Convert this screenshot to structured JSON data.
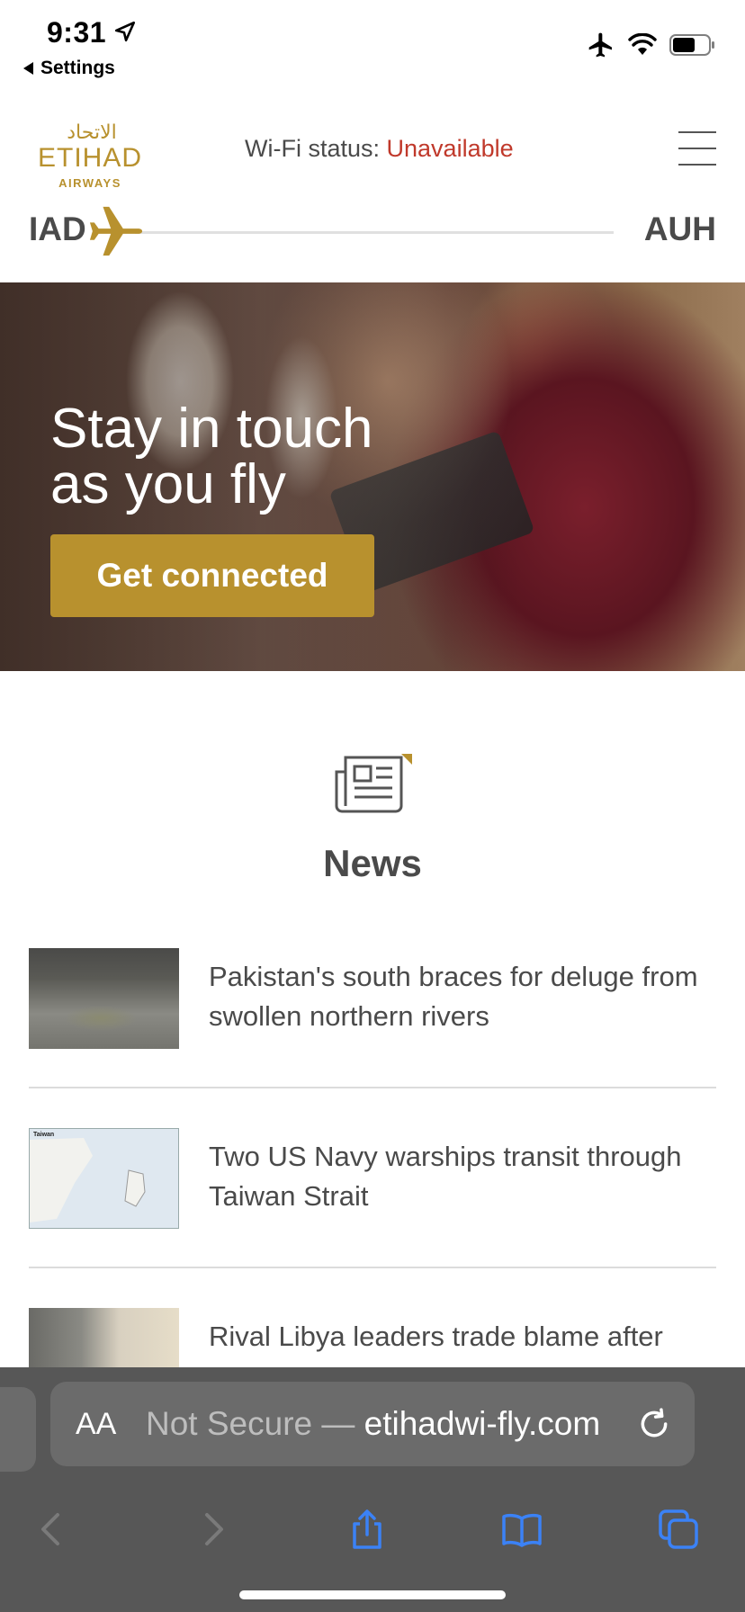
{
  "status_bar": {
    "time": "9:31",
    "back_label": "Settings"
  },
  "header": {
    "logo_arabic": "الاتحاد",
    "logo_main": "ETIHAD",
    "logo_sub": "AIRWAYS",
    "wifi_label": "Wi-Fi status:",
    "wifi_value": "Unavailable",
    "brand_color": "#b8912e",
    "status_color": "#c0392b"
  },
  "route": {
    "from": "IAD",
    "to": "AUH"
  },
  "hero": {
    "title_line1": "Stay in touch",
    "title_line2": "as you fly",
    "button_label": "Get connected"
  },
  "news": {
    "title": "News",
    "items": [
      {
        "headline": "Pakistan's south braces for deluge from swollen northern rivers"
      },
      {
        "headline": "Two US Navy warships transit through Taiwan Strait",
        "thumb_label": "Taiwan"
      },
      {
        "headline": "Rival Libya leaders trade blame after"
      }
    ]
  },
  "browser": {
    "aa_label": "AA",
    "not_secure": "Not Secure —",
    "domain": "etihadwi-fly.com"
  }
}
